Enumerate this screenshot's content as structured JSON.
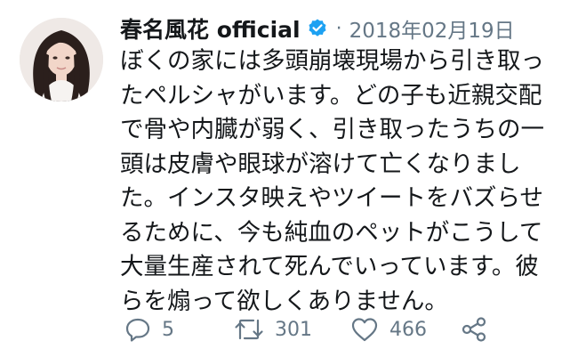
{
  "tweet": {
    "display_name": "春名風花 official",
    "verified": true,
    "separator": "·",
    "date": "2018年02月19日",
    "body_lines": [
      "ぼくの家には多頭崩壊現場から引き取っ",
      "たペルシャがいます。どの子も近親交配",
      "で骨や内臓が弱く、引き取ったうちの一",
      "頭は皮膚や眼球が溶けて亡くなりまし",
      "た。インスタ映えやツイートをバズらせ",
      "るために、今も純血のペットがこうして",
      "大量生産されて死んでいっています。彼",
      "らを煽って欲しくありません。"
    ]
  },
  "actions": {
    "reply": {
      "icon": "reply-icon",
      "count": "5"
    },
    "retweet": {
      "icon": "retweet-icon",
      "count": "301"
    },
    "like": {
      "icon": "heart-icon",
      "count": "466"
    },
    "share": {
      "icon": "share-icon"
    }
  },
  "colors": {
    "text": "#14171a",
    "muted": "#657786",
    "verified": "#1da1f2"
  }
}
